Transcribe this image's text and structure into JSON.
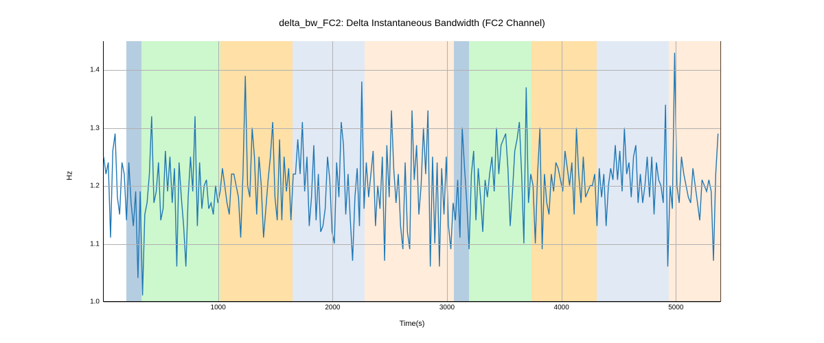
{
  "chart_data": {
    "type": "line",
    "title": "delta_bw_FC2: Delta Instantaneous Bandwidth (FC2 Channel)",
    "xlabel": "Time(s)",
    "ylabel": "Hz",
    "xlim": [
      0,
      5400
    ],
    "ylim": [
      1.0,
      1.45
    ],
    "xticks": [
      1000,
      2000,
      3000,
      4000,
      5000
    ],
    "yticks": [
      1.0,
      1.1,
      1.2,
      1.3,
      1.4
    ],
    "line_color": "#1f77b4",
    "bands": [
      {
        "start": 200,
        "end": 330,
        "color": "rgba(70,130,180,0.40)"
      },
      {
        "start": 330,
        "end": 1020,
        "color": "rgba(144,238,144,0.45)"
      },
      {
        "start": 1020,
        "end": 1650,
        "color": "rgba(255,165,0,0.35)"
      },
      {
        "start": 1650,
        "end": 2280,
        "color": "rgba(200,215,235,0.55)"
      },
      {
        "start": 2280,
        "end": 3060,
        "color": "rgba(255,200,150,0.35)"
      },
      {
        "start": 3060,
        "end": 3190,
        "color": "rgba(70,130,180,0.40)"
      },
      {
        "start": 3190,
        "end": 3740,
        "color": "rgba(144,238,144,0.45)"
      },
      {
        "start": 3740,
        "end": 4310,
        "color": "rgba(255,165,0,0.35)"
      },
      {
        "start": 4310,
        "end": 4940,
        "color": "rgba(200,215,235,0.55)"
      },
      {
        "start": 4940,
        "end": 5400,
        "color": "rgba(255,200,150,0.35)"
      }
    ],
    "x": [
      0,
      20,
      40,
      60,
      80,
      100,
      120,
      140,
      160,
      180,
      200,
      220,
      240,
      260,
      280,
      300,
      320,
      340,
      360,
      380,
      400,
      420,
      440,
      460,
      480,
      500,
      520,
      540,
      560,
      580,
      600,
      620,
      640,
      660,
      680,
      700,
      720,
      740,
      760,
      780,
      800,
      820,
      840,
      860,
      880,
      900,
      920,
      940,
      960,
      980,
      1000,
      1020,
      1040,
      1060,
      1080,
      1100,
      1120,
      1140,
      1160,
      1180,
      1200,
      1220,
      1240,
      1260,
      1280,
      1300,
      1320,
      1340,
      1360,
      1380,
      1400,
      1420,
      1440,
      1460,
      1480,
      1500,
      1520,
      1540,
      1560,
      1580,
      1600,
      1620,
      1640,
      1660,
      1680,
      1700,
      1720,
      1740,
      1760,
      1780,
      1800,
      1820,
      1840,
      1860,
      1880,
      1900,
      1920,
      1940,
      1960,
      1980,
      2000,
      2020,
      2040,
      2060,
      2080,
      2100,
      2120,
      2140,
      2160,
      2180,
      2200,
      2220,
      2240,
      2260,
      2280,
      2300,
      2320,
      2340,
      2360,
      2380,
      2400,
      2420,
      2440,
      2460,
      2480,
      2500,
      2520,
      2540,
      2560,
      2580,
      2600,
      2620,
      2640,
      2660,
      2680,
      2700,
      2720,
      2740,
      2760,
      2780,
      2800,
      2820,
      2840,
      2860,
      2880,
      2900,
      2920,
      2940,
      2960,
      2980,
      3000,
      3020,
      3040,
      3060,
      3080,
      3100,
      3120,
      3140,
      3160,
      3180,
      3200,
      3220,
      3240,
      3260,
      3280,
      3300,
      3320,
      3340,
      3360,
      3380,
      3400,
      3420,
      3440,
      3460,
      3480,
      3500,
      3520,
      3540,
      3560,
      3580,
      3600,
      3620,
      3640,
      3660,
      3680,
      3700,
      3720,
      3740,
      3760,
      3780,
      3800,
      3820,
      3840,
      3860,
      3880,
      3900,
      3920,
      3940,
      3960,
      3980,
      4000,
      4020,
      4040,
      4060,
      4080,
      4100,
      4120,
      4140,
      4160,
      4180,
      4200,
      4220,
      4240,
      4260,
      4280,
      4300,
      4320,
      4340,
      4360,
      4380,
      4400,
      4420,
      4440,
      4460,
      4480,
      4500,
      4520,
      4540,
      4560,
      4580,
      4600,
      4620,
      4640,
      4660,
      4680,
      4700,
      4720,
      4740,
      4760,
      4780,
      4800,
      4820,
      4840,
      4860,
      4880,
      4900,
      4920,
      4940,
      4960,
      4980,
      5000,
      5020,
      5040,
      5060,
      5080,
      5100,
      5120,
      5140,
      5160,
      5180,
      5200,
      5220,
      5240,
      5260,
      5280,
      5300,
      5320,
      5340,
      5360,
      5380,
      5400
    ],
    "y": [
      1.25,
      1.22,
      1.24,
      1.11,
      1.26,
      1.29,
      1.18,
      1.15,
      1.24,
      1.22,
      1.14,
      1.24,
      1.17,
      1.13,
      1.19,
      1.04,
      1.19,
      1.01,
      1.15,
      1.17,
      1.22,
      1.32,
      1.17,
      1.19,
      1.24,
      1.14,
      1.16,
      1.26,
      1.19,
      1.25,
      1.17,
      1.23,
      1.06,
      1.24,
      1.18,
      1.13,
      1.06,
      1.18,
      1.25,
      1.19,
      1.32,
      1.13,
      1.24,
      1.16,
      1.2,
      1.21,
      1.16,
      1.17,
      1.15,
      1.2,
      1.17,
      1.19,
      1.23,
      1.2,
      1.17,
      1.15,
      1.22,
      1.22,
      1.2,
      1.18,
      1.11,
      1.22,
      1.39,
      1.2,
      1.18,
      1.3,
      1.25,
      1.15,
      1.25,
      1.2,
      1.11,
      1.16,
      1.21,
      1.25,
      1.31,
      1.18,
      1.14,
      1.28,
      1.14,
      1.25,
      1.19,
      1.23,
      1.14,
      1.22,
      1.22,
      1.28,
      1.22,
      1.31,
      1.19,
      1.25,
      1.13,
      1.18,
      1.27,
      1.14,
      1.22,
      1.12,
      1.13,
      1.16,
      1.25,
      1.21,
      1.12,
      1.1,
      1.24,
      1.18,
      1.31,
      1.27,
      1.15,
      1.22,
      1.14,
      1.07,
      1.18,
      1.23,
      1.13,
      1.38,
      1.16,
      1.24,
      1.18,
      1.22,
      1.26,
      1.13,
      1.2,
      1.16,
      1.25,
      1.07,
      1.27,
      1.18,
      1.33,
      1.23,
      1.17,
      1.22,
      1.13,
      1.09,
      1.24,
      1.12,
      1.09,
      1.33,
      1.21,
      1.27,
      1.15,
      1.2,
      1.3,
      1.22,
      1.33,
      1.06,
      1.25,
      1.1,
      1.24,
      1.06,
      1.23,
      1.15,
      1.25,
      1.13,
      1.09,
      1.17,
      1.14,
      1.21,
      1.11,
      1.3,
      1.23,
      1.17,
      1.09,
      1.22,
      1.26,
      1.14,
      1.23,
      1.18,
      1.12,
      1.21,
      1.18,
      1.22,
      1.25,
      1.19,
      1.3,
      1.22,
      1.27,
      1.28,
      1.29,
      1.23,
      1.13,
      1.19,
      1.26,
      1.28,
      1.31,
      1.22,
      1.1,
      1.37,
      1.17,
      1.22,
      1.2,
      1.1,
      1.22,
      1.3,
      1.09,
      1.22,
      1.17,
      1.15,
      1.22,
      1.19,
      1.24,
      1.23,
      1.21,
      1.19,
      1.26,
      1.23,
      1.2,
      1.24,
      1.15,
      1.3,
      1.22,
      1.17,
      1.25,
      1.18,
      1.19,
      1.2,
      1.2,
      1.22,
      1.13,
      1.23,
      1.18,
      1.22,
      1.13,
      1.2,
      1.23,
      1.21,
      1.27,
      1.21,
      1.26,
      1.19,
      1.3,
      1.22,
      1.24,
      1.18,
      1.25,
      1.27,
      1.17,
      1.22,
      1.17,
      1.2,
      1.25,
      1.18,
      1.25,
      1.15,
      1.24,
      1.21,
      1.2,
      1.17,
      1.34,
      1.06,
      1.2,
      1.16,
      1.43,
      1.2,
      1.17,
      1.25,
      1.22,
      1.2,
      1.18,
      1.17,
      1.23,
      1.2,
      1.17,
      1.14,
      1.21,
      1.2,
      1.19,
      1.21,
      1.19,
      1.07,
      1.22,
      1.29
    ]
  }
}
